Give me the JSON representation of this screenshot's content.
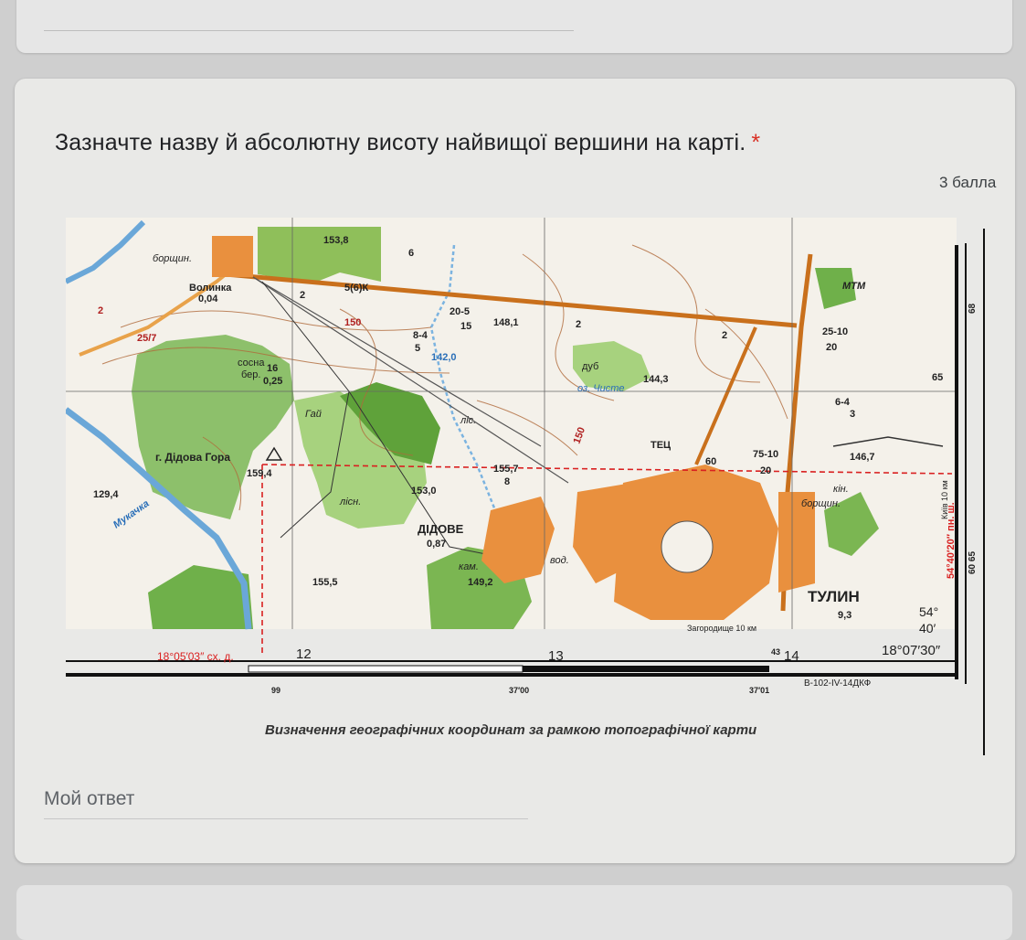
{
  "question": {
    "text": "Зазначте назву й абсолютну висоту найвищої вершини на карті.",
    "required_mark": "*",
    "points": "3 балла"
  },
  "map": {
    "caption": "Визначення географічних координат за рамкою топографічної карти",
    "labels": {
      "borshchiv": "борщин.",
      "volynka": "Волинка",
      "volynka_val": "0,04",
      "h1538": "153,8",
      "v6": "6",
      "v56k": "5(6)К",
      "v150": "150",
      "v2a": "2",
      "v2b": "2",
      "v2c": "2",
      "v2d": "2",
      "v25_7": "25/7",
      "k20_5": "20-5",
      "v15": "15",
      "h1481": "148,1",
      "mtm": "МТМ",
      "v68": "68",
      "k25_10": "25-10",
      "v20": "20",
      "sosna": "сосна",
      "ber": "бер.",
      "v16": "16",
      "v025": "0,25",
      "d8_4": "8-4",
      "v5": "5",
      "h1420": "142,0",
      "dub": "дуб",
      "h1443": "144,3",
      "oz_chyste": "оз. Чисте",
      "v65": "65",
      "d6_4": "6-4",
      "v3": "3",
      "gai": "Гай",
      "lis": "ліс.",
      "v150b": "150",
      "teci": "ТЕЦ",
      "v60": "60",
      "k75_10": "75-10",
      "v20b": "20",
      "h1467": "146,7",
      "kin": "кін.",
      "borshch2": "борщин.",
      "didova_gora": "г. Дідова Гора",
      "h1594": "159,4",
      "h1557": "155,7",
      "v8": "8",
      "h1530": "153,0",
      "lisn": "лісн.",
      "h1294": "129,4",
      "mukachka": "Мукачка",
      "didove": "ДІДОВЕ",
      "didove_val": "0,87",
      "kam": "кам.",
      "h1492": "149,2",
      "vod": "вод.",
      "h1555": "155,5",
      "tulyn": "ТУЛИН",
      "tulyn_val": "9,3",
      "zagorodyshche": "Загородище 10 км",
      "kyiv": "Київ 10 км",
      "lat_red": "54°40′20″ пн. ш.",
      "lon_red": "18°05′03″ сх. д.",
      "grid12": "12",
      "grid13": "13",
      "grid14": "14",
      "grid43": "43",
      "deg54": "54°",
      "min40": "40′",
      "lon_corner": "18°07′30″",
      "v99": "99",
      "v3700": "37′00",
      "v3701": "37′01",
      "v6065": "60 65",
      "sheet": "В-102-IV-14ДКФ"
    }
  },
  "answer": {
    "label": "Мой ответ"
  }
}
